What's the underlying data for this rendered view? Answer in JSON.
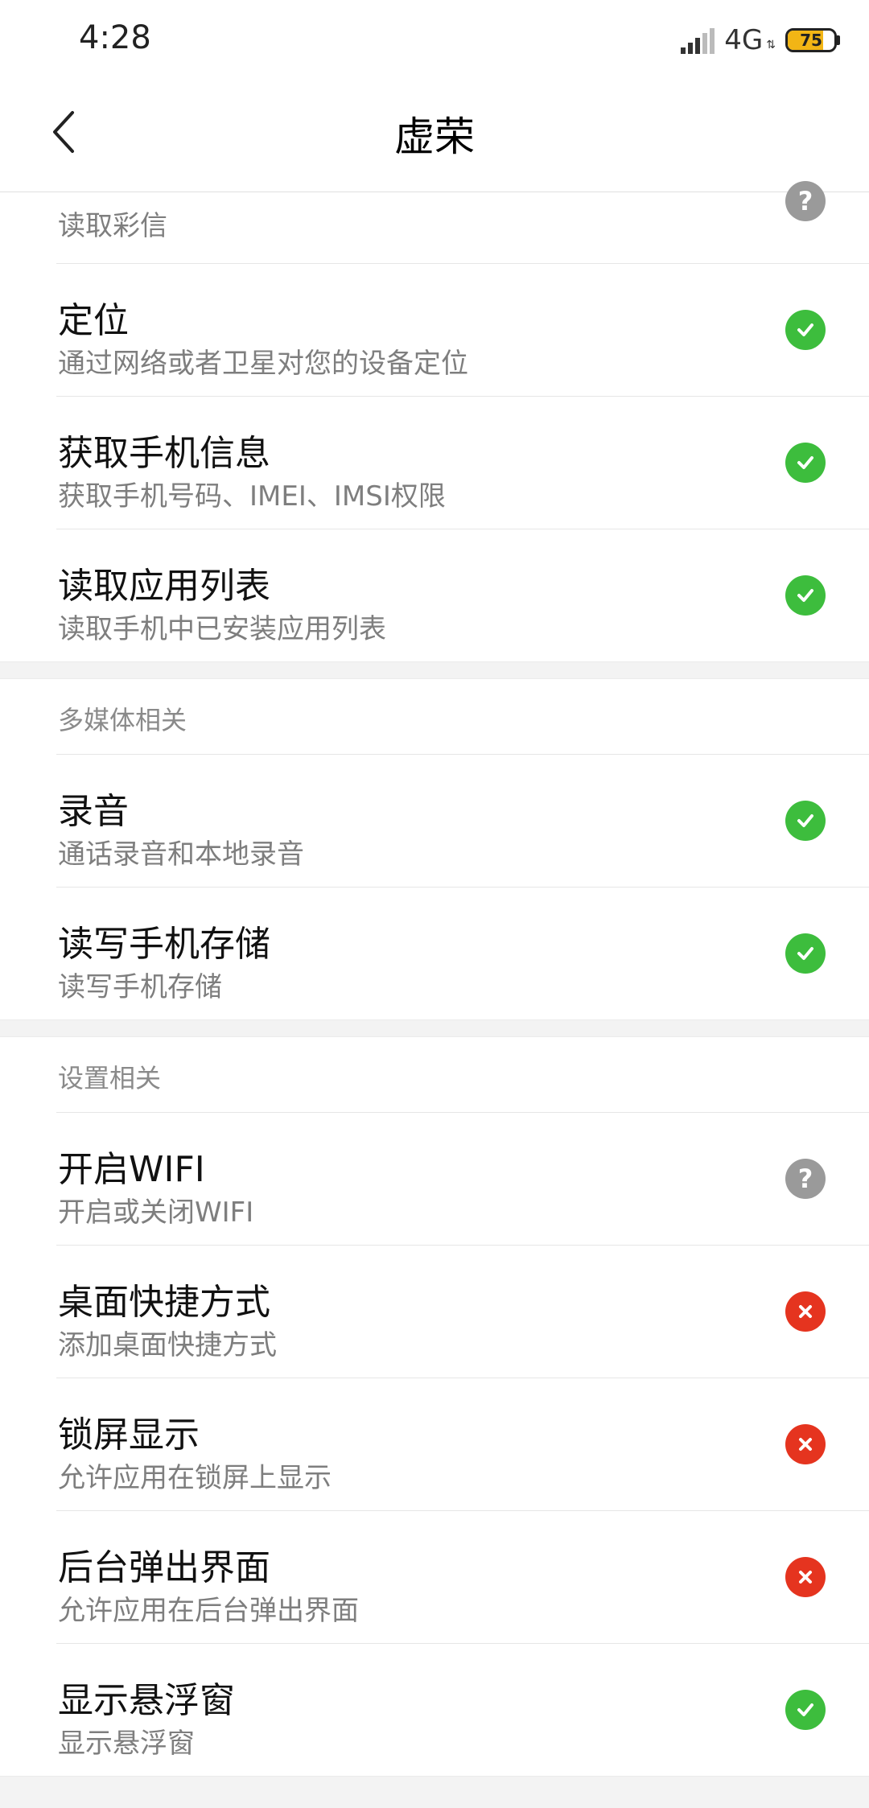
{
  "status_bar": {
    "time": "4:28",
    "network": "4G",
    "battery": "75",
    "battery_percent": 75
  },
  "nav": {
    "title": "虚荣"
  },
  "partial_item": {
    "desc": "读取彩信",
    "status": "ask"
  },
  "sections": [
    {
      "header": "",
      "items": [
        {
          "title": "定位",
          "desc": "通过网络或者卫星对您的设备定位",
          "status": "ok"
        },
        {
          "title": "获取手机信息",
          "desc": "获取手机号码、IMEI、IMSI权限",
          "status": "ok"
        },
        {
          "title": "读取应用列表",
          "desc": "读取手机中已安装应用列表",
          "status": "ok"
        }
      ]
    },
    {
      "header": "多媒体相关",
      "items": [
        {
          "title": "录音",
          "desc": "通话录音和本地录音",
          "status": "ok"
        },
        {
          "title": "读写手机存储",
          "desc": "读写手机存储",
          "status": "ok"
        }
      ]
    },
    {
      "header": "设置相关",
      "items": [
        {
          "title": "开启WIFI",
          "desc": "开启或关闭WIFI",
          "status": "ask"
        },
        {
          "title": "桌面快捷方式",
          "desc": "添加桌面快捷方式",
          "status": "deny"
        },
        {
          "title": "锁屏显示",
          "desc": "允许应用在锁屏上显示",
          "status": "deny"
        },
        {
          "title": "后台弹出界面",
          "desc": "允许应用在后台弹出界面",
          "status": "deny"
        },
        {
          "title": "显示悬浮窗",
          "desc": "显示悬浮窗",
          "status": "ok"
        }
      ]
    }
  ],
  "colors": {
    "ok": "#3dbd3d",
    "deny": "#e5341f",
    "ask": "#9a9a9a"
  },
  "icons": {
    "ok": "check-icon",
    "deny": "cross-icon",
    "ask": "question-icon"
  }
}
